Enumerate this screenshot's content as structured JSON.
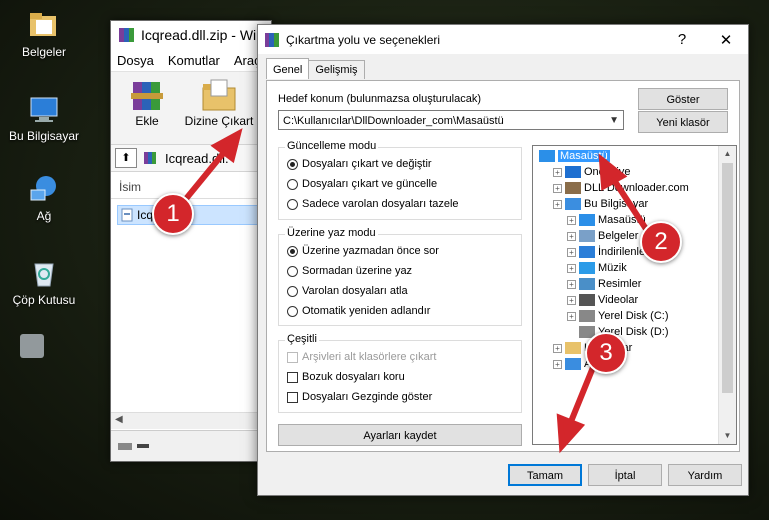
{
  "desktop": {
    "icons": [
      {
        "label": "Belgeler",
        "icon": "folder-icon"
      },
      {
        "label": "Bu Bilgisayar",
        "icon": "computer-icon"
      },
      {
        "label": "Ağ",
        "icon": "network-icon"
      },
      {
        "label": "Çöp Kutusu",
        "icon": "recycle-bin-icon"
      }
    ]
  },
  "winrar": {
    "title": "Icqread.dll.zip - Win",
    "menu": [
      "Dosya",
      "Komutlar",
      "Araçla"
    ],
    "toolbar": [
      "Ekle",
      "Dizine Çıkart"
    ],
    "path": "Icqread.dll.",
    "column_name": "İsim",
    "file": "Icqread.dll"
  },
  "dialog": {
    "title": "Çıkartma yolu ve seçenekleri",
    "help": "?",
    "close": "✕",
    "tabs": [
      "Genel",
      "Gelişmiş"
    ],
    "dest_label": "Hedef konum (bulunmazsa oluşturulacak)",
    "dest_value": "C:\\Kullanıcılar\\DllDownloader_com\\Masaüstü",
    "show_button": "Göster",
    "new_folder_button": "Yeni klasör",
    "update_mode": {
      "title": "Güncelleme modu",
      "options": [
        "Dosyaları çıkart ve değiştir",
        "Dosyaları çıkart ve güncelle",
        "Sadece varolan dosyaları tazele"
      ],
      "selected": 0
    },
    "overwrite_mode": {
      "title": "Üzerine yaz modu",
      "options": [
        "Üzerine yazmadan önce sor",
        "Sormadan üzerine yaz",
        "Varolan dosyaları atla",
        "Otomatik yeniden adlandır"
      ],
      "selected": 0
    },
    "misc": {
      "title": "Çeşitli",
      "options": [
        "Arşivleri alt klasörlere çıkart",
        "Bozuk dosyaları koru",
        "Dosyaları Gezginde göster"
      ],
      "disabled": [
        true,
        false,
        false
      ],
      "checked": [
        false,
        false,
        false
      ]
    },
    "save_settings": "Ayarları kaydet",
    "tree": [
      {
        "label": "Masaüstü",
        "level": 0,
        "icon": "desktop-icon",
        "selected": true
      },
      {
        "label": "OneDrive",
        "level": 1,
        "icon": "cloud-icon"
      },
      {
        "label": "DLL Downloader.com",
        "level": 1,
        "icon": "user-icon"
      },
      {
        "label": "Bu Bilgisayar",
        "level": 1,
        "icon": "computer-icon"
      },
      {
        "label": "Masaüstü",
        "level": 2,
        "icon": "desktop-icon"
      },
      {
        "label": "Belgeler",
        "level": 2,
        "icon": "documents-icon"
      },
      {
        "label": "İndirilenler",
        "level": 2,
        "icon": "download-icon"
      },
      {
        "label": "Müzik",
        "level": 2,
        "icon": "music-icon"
      },
      {
        "label": "Resimler",
        "level": 2,
        "icon": "pictures-icon"
      },
      {
        "label": "Videolar",
        "level": 2,
        "icon": "video-icon"
      },
      {
        "label": "Yerel Disk (C:)",
        "level": 2,
        "icon": "disk-icon"
      },
      {
        "label": "Yerel Disk (D:)",
        "level": 2,
        "icon": "disk-icon"
      },
      {
        "label": "Kitaplıklar",
        "level": 1,
        "icon": "library-icon"
      },
      {
        "label": "Ağ",
        "level": 1,
        "icon": "network-icon"
      }
    ],
    "buttons": {
      "ok": "Tamam",
      "cancel": "İptal",
      "help": "Yardım"
    }
  },
  "callouts": [
    "1",
    "2",
    "3"
  ],
  "colors": {
    "callout": "#d3262b",
    "selection": "#3399ff",
    "arrow": "#d3262b"
  }
}
